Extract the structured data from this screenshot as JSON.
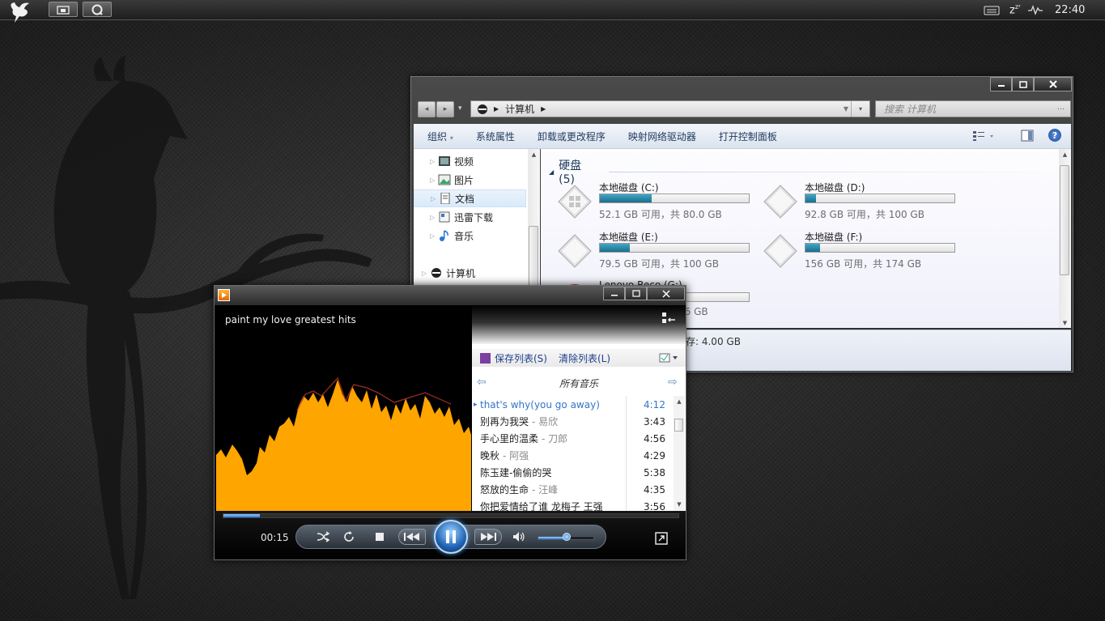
{
  "taskbar": {
    "clock": "22:40",
    "sleep_glyph": "z",
    "sleep_superscript": "zᶻ"
  },
  "explorer": {
    "breadcrumb": "计算机",
    "search_placeholder": "搜索 计算机",
    "toolbar": [
      "组织",
      "系统属性",
      "卸载或更改程序",
      "映射网络驱动器",
      "打开控制面板"
    ],
    "nav": [
      {
        "label": "视频"
      },
      {
        "label": "图片"
      },
      {
        "label": "文档"
      },
      {
        "label": "迅雷下载"
      },
      {
        "label": "音乐"
      },
      {
        "label": "计算机"
      }
    ],
    "section": "硬盘 (5)",
    "drives": [
      {
        "name": "本地磁盘 (C:)",
        "free": "52.1 GB 可用，共 80.0 GB",
        "used_fraction": 0.35
      },
      {
        "name": "本地磁盘 (D:)",
        "free": "92.8 GB 可用，共 100 GB",
        "used_fraction": 0.07
      },
      {
        "name": "本地磁盘 (E:)",
        "free": "79.5 GB 可用，共 100 GB",
        "used_fraction": 0.2
      },
      {
        "name": "本地磁盘 (F:)",
        "free": "156 GB 可用，共 174 GB",
        "used_fraction": 0.1
      }
    ],
    "partial_drive_name": "Lenovo Reco (G:)",
    "partial_drive_free": "76 GB",
    "details_text": "存: 4.00 GB"
  },
  "player": {
    "now_playing": "paint my love greatest hits",
    "save_list": "保存列表(S)",
    "clear_list": "清除列表(L)",
    "list_title": "所有音乐",
    "elapsed": "00:15",
    "progress_fraction": 0.08,
    "volume_fraction": 0.52,
    "tracks": [
      {
        "title": "that's why(you go away)",
        "artist": "",
        "duration": "4:12",
        "active": true
      },
      {
        "title": "别再为我哭",
        "artist": "- 易欣",
        "duration": "3:43"
      },
      {
        "title": "手心里的温柔",
        "artist": "- 刀郎",
        "duration": "4:56"
      },
      {
        "title": "晚秋",
        "artist": "- 阿强",
        "duration": "4:29"
      },
      {
        "title": "陈玉建-偷偷的哭",
        "artist": "",
        "duration": "5:38"
      },
      {
        "title": "怒放的生命",
        "artist": "- 汪峰",
        "duration": "4:35"
      },
      {
        "title": "你把爱情给了谁 龙梅子 王强",
        "artist": "",
        "duration": "3:56"
      }
    ]
  },
  "colors": {
    "accent_blue": "#3375c8",
    "drive_fill": "#2688a8",
    "visualizer": "#ffa500"
  }
}
